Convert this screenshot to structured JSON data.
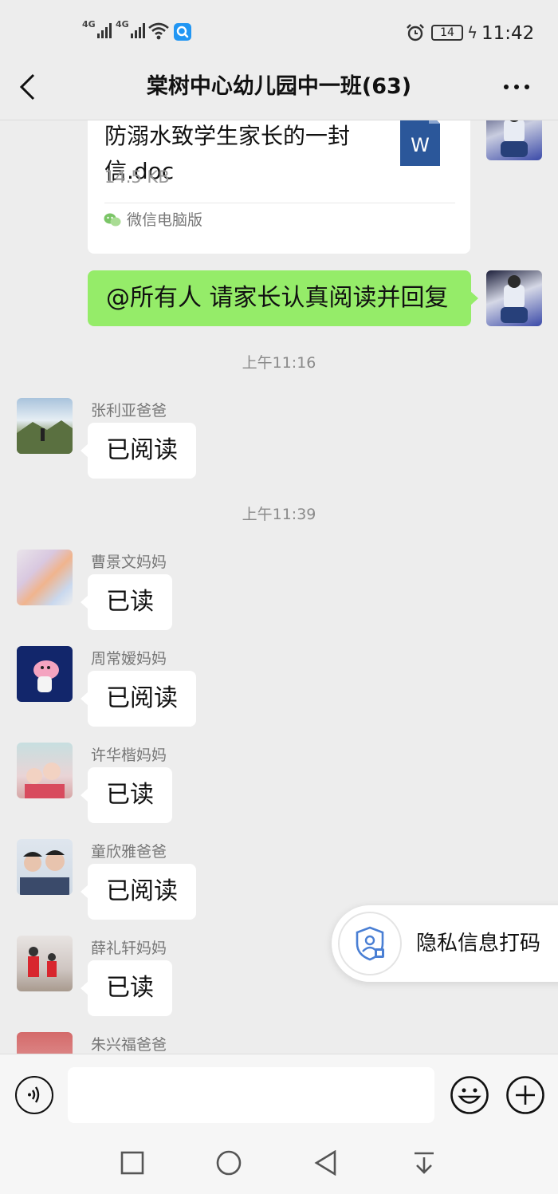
{
  "status_bar": {
    "signal1_label": "4G",
    "signal2_label": "4G",
    "battery": "14",
    "time": "11:42"
  },
  "header": {
    "title": "棠树中心幼儿园中一班(63)"
  },
  "file_message": {
    "filename": "防溺水致学生家长的一封信.doc",
    "size": "14.5 KB",
    "source": "微信电脑版",
    "doc_letter": "W"
  },
  "my_message": {
    "text": "@所有人  请家长认真阅读并回复"
  },
  "timestamps": [
    "上午11:16",
    "上午11:39"
  ],
  "messages": [
    {
      "sender": "张利亚爸爸",
      "text": "已阅读"
    },
    {
      "sender": "曹景文妈妈",
      "text": "已读"
    },
    {
      "sender": "周常嫒妈妈",
      "text": "已阅读"
    },
    {
      "sender": "许华楷妈妈",
      "text": "已读"
    },
    {
      "sender": "童欣雅爸爸",
      "text": "已阅读"
    },
    {
      "sender": "薛礼轩妈妈",
      "text": "已读"
    },
    {
      "sender": "朱兴福爸爸",
      "text": ""
    }
  ],
  "privacy_button": {
    "label": "隐私信息打码"
  },
  "colors": {
    "background": "#ededed",
    "my_bubble": "#95ec69",
    "other_bubble": "#ffffff",
    "privacy_icon": "#4a7fd4"
  },
  "icons": [
    "back-icon",
    "more-icon",
    "word-doc-icon",
    "wechat-icon",
    "privacy-shield-icon",
    "voice-icon",
    "emoji-icon",
    "plus-icon",
    "recent-apps-icon",
    "home-icon",
    "back-nav-icon",
    "notification-icon"
  ]
}
